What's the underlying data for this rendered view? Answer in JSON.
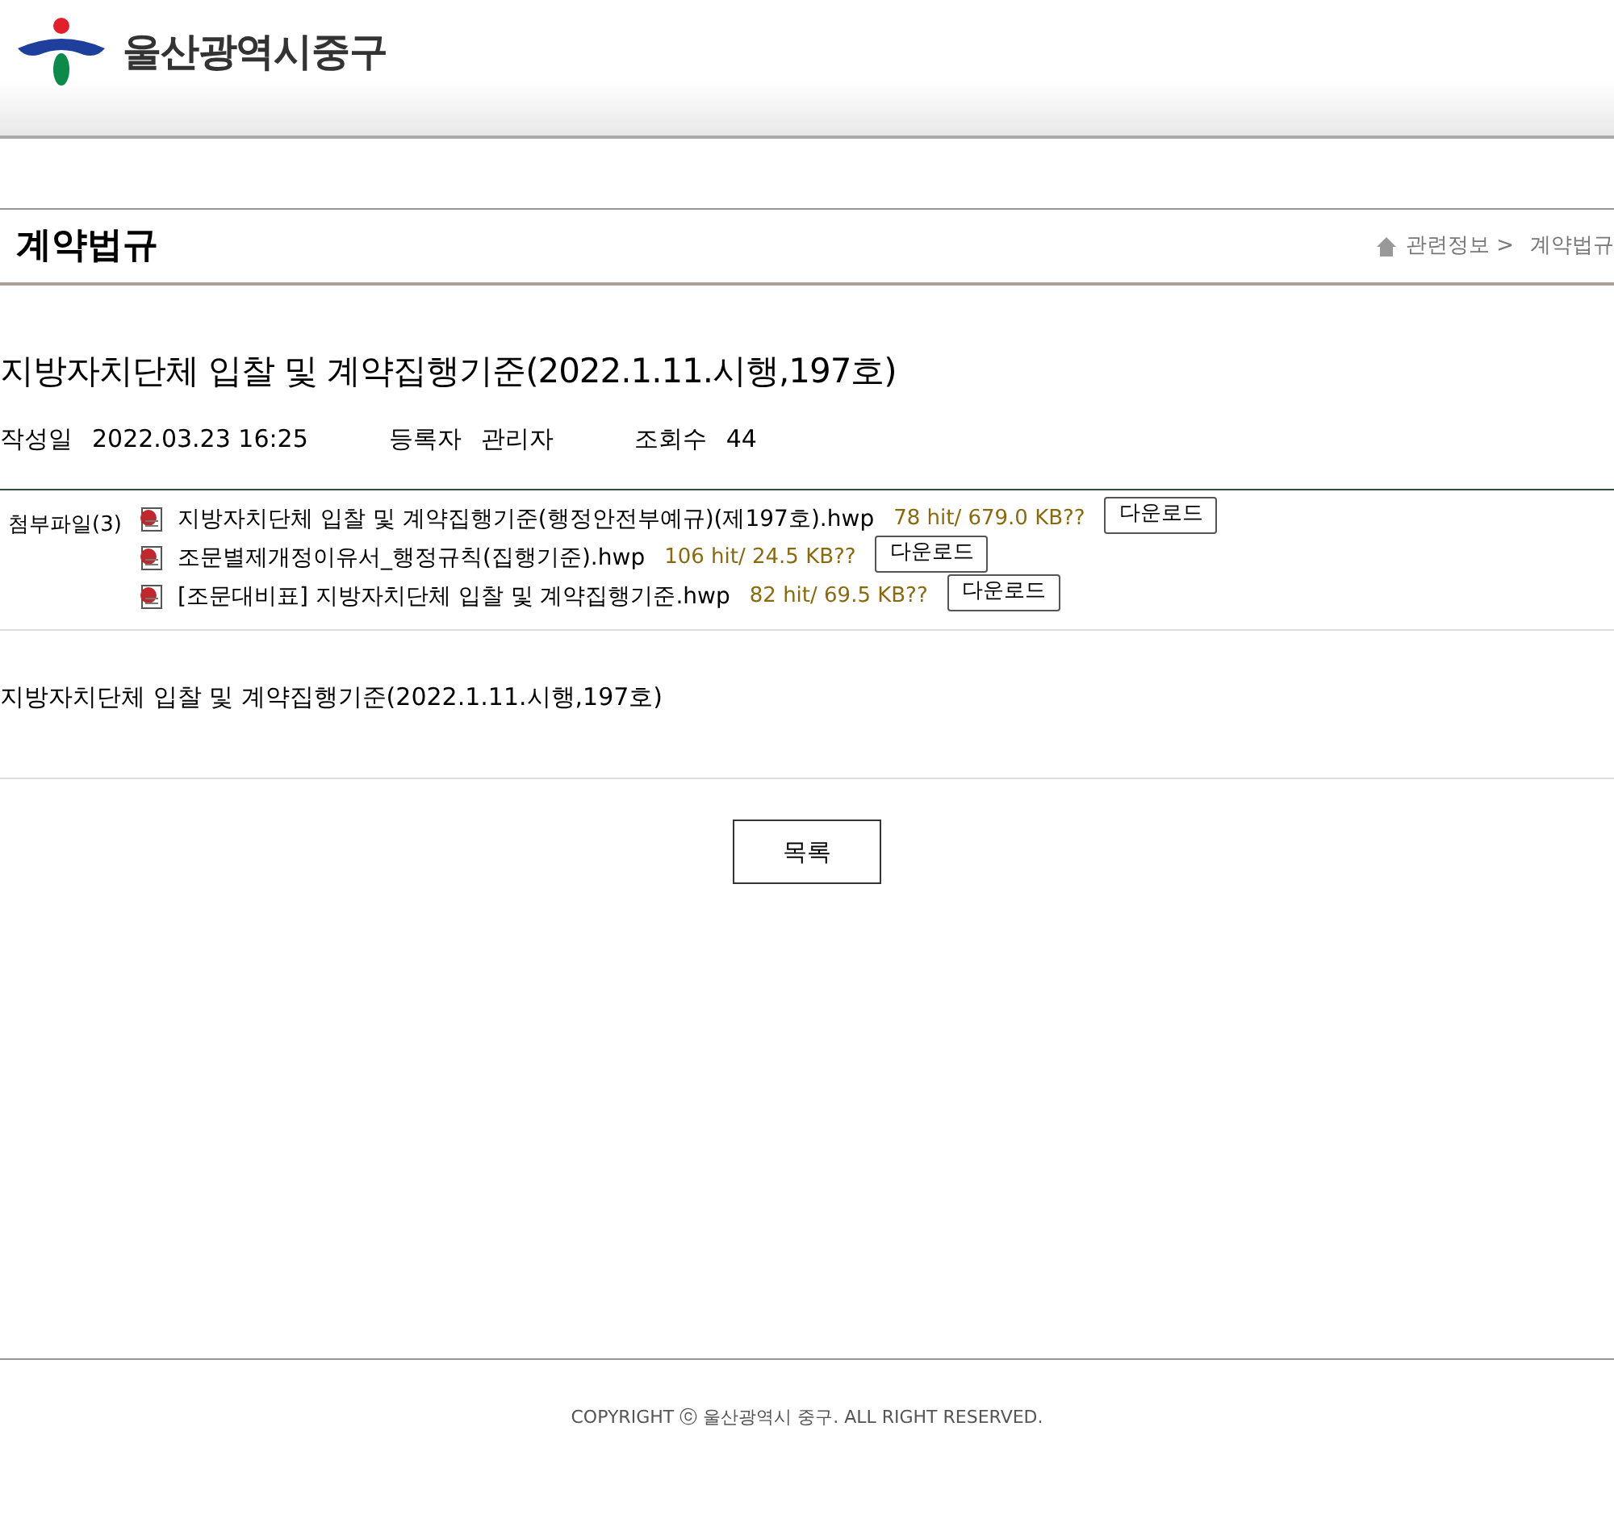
{
  "header": {
    "site_name": "울산광역시중구"
  },
  "page": {
    "title": "계약법규",
    "breadcrumb": [
      "관련정보 >",
      "계약법규"
    ]
  },
  "post": {
    "title": "지방자치단체 입찰 및 계약집행기준(2022.1.11.시행,197호)",
    "meta": [
      {
        "label": "작성일",
        "value": "2022.03.23 16:25"
      },
      {
        "label": "등록자",
        "value": "관리자"
      },
      {
        "label": "조회수",
        "value": "44"
      }
    ],
    "attachments_label": "첨부파일(3)",
    "attachments": [
      {
        "name": "지방자치단체 입찰 및 계약집행기준(행정안전부예규)(제197호).hwp",
        "info": "78 hit/ 679.0 KB??",
        "button": "다운로드"
      },
      {
        "name": "조문별제개정이유서_행정규칙(집행기준).hwp",
        "info": "106 hit/ 24.5 KB??",
        "button": "다운로드"
      },
      {
        "name": "[조문대비표] 지방자치단체 입찰 및 계약집행기준.hwp",
        "info": "82 hit/ 69.5 KB??",
        "button": "다운로드"
      }
    ],
    "body": "지방자치단체 입찰 및 계약집행기준(2022.1.11.시행,197호)",
    "list_button": "목록"
  },
  "footer": {
    "copyright": "COPYRIGHT ⓒ 울산광역시 중구. ALL RIGHT RESERVED."
  }
}
